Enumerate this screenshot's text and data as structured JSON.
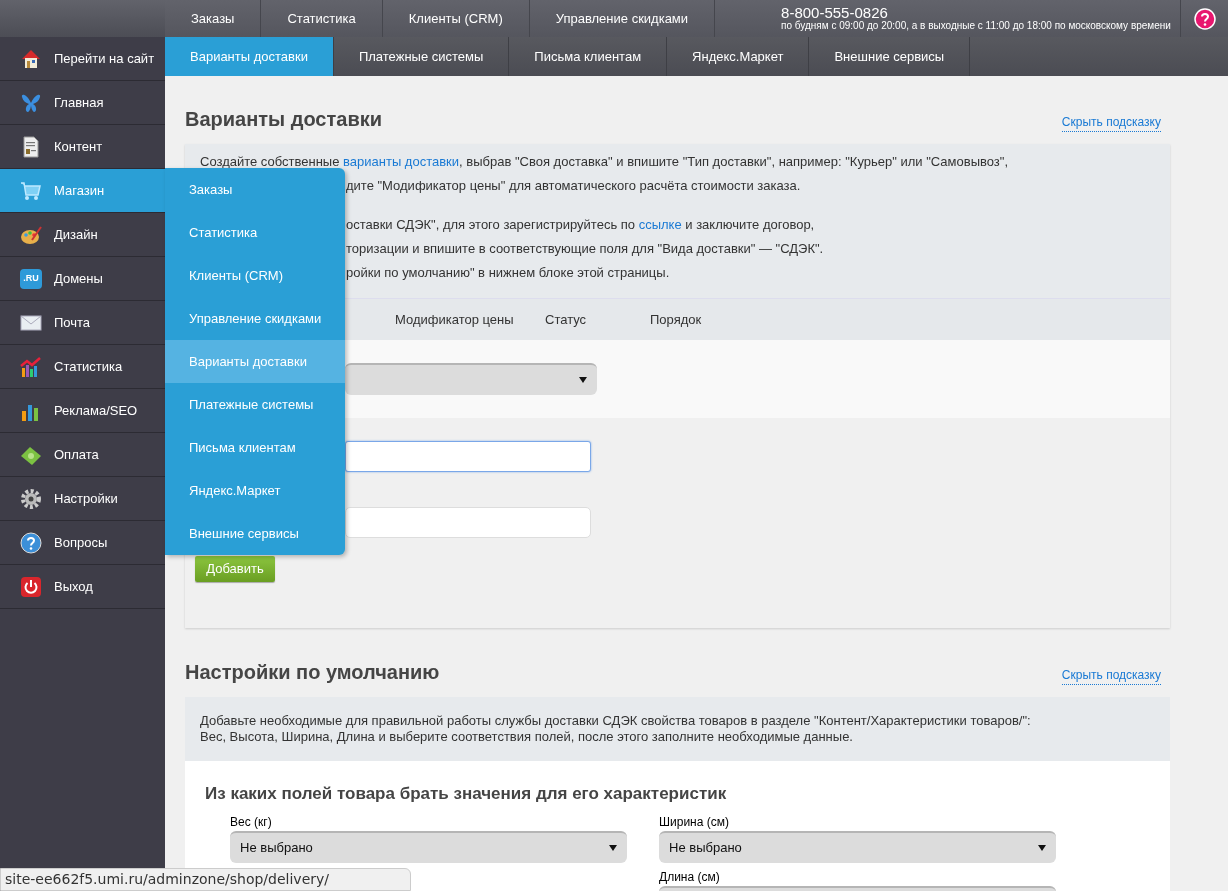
{
  "sidebar": {
    "items": [
      {
        "label": "Перейти на сайт",
        "selected": false
      },
      {
        "label": "Главная",
        "selected": false
      },
      {
        "label": "Контент",
        "selected": false
      },
      {
        "label": "Магазин",
        "selected": true
      },
      {
        "label": "Дизайн",
        "selected": false
      },
      {
        "label": "Домены",
        "selected": false,
        "icon_text": ".RU"
      },
      {
        "label": "Почта",
        "selected": false
      },
      {
        "label": "Статистика",
        "selected": false
      },
      {
        "label": "Реклама/SEO",
        "selected": false
      },
      {
        "label": "Оплата",
        "selected": false
      },
      {
        "label": "Настройки",
        "selected": false
      },
      {
        "label": "Вопросы",
        "selected": false
      },
      {
        "label": "Выход",
        "selected": false
      }
    ]
  },
  "top_tabs": [
    {
      "label": "Заказы",
      "selected": false
    },
    {
      "label": "Статистика",
      "selected": false
    },
    {
      "label": "Клиенты (CRM)",
      "selected": false
    },
    {
      "label": "Управление скидками",
      "selected": false
    }
  ],
  "contact": {
    "phone": "8-800-555-0826",
    "hours": "по будням с 09:00 до 20:00, а в выходные с 11:00 до 18:00 по московскому времени"
  },
  "sub_tabs": [
    {
      "label": "Варианты доставки",
      "selected": true
    },
    {
      "label": "Платежные системы",
      "selected": false
    },
    {
      "label": "Письма клиентам",
      "selected": false
    },
    {
      "label": "Яндекс.Маркет",
      "selected": false
    },
    {
      "label": "Внешние сервисы",
      "selected": false
    }
  ],
  "flyout_menu": [
    {
      "label": "Заказы",
      "selected": false
    },
    {
      "label": "Статистика",
      "selected": false
    },
    {
      "label": "Клиенты (CRM)",
      "selected": false
    },
    {
      "label": "Управление скидками",
      "selected": false
    },
    {
      "label": "Варианты доставки",
      "selected": true
    },
    {
      "label": "Платежные системы",
      "selected": false
    },
    {
      "label": "Письма клиентам",
      "selected": false
    },
    {
      "label": "Яндекс.Маркет",
      "selected": false
    },
    {
      "label": "Внешние сервисы",
      "selected": false
    }
  ],
  "delivery_section": {
    "title": "Варианты доставки",
    "hide_hint": "Скрыть подсказку",
    "hint_paragraphs": [
      [
        [
          {
            "text": "Создайте собственные "
          },
          {
            "text": "варианты доставки",
            "link": true
          },
          {
            "text": ", выбрав \"Своя доставка\" и впишите \"Тип доставки\", например: \"Курьер\" или \"Самовывоз\","
          }
        ],
        [
          {
            "text": "дите \"Модификатор цены\" для автоматического расчёта стоимости заказа."
          }
        ]
      ],
      [
        [
          {
            "text": "оставки СДЭК\", для этого зарегистрируйтесь по "
          },
          {
            "text": "ссылке",
            "link": true
          },
          {
            "text": " и заключите договор,"
          }
        ],
        [
          {
            "text": "торизации и впишите в соответствующие поля для \"Вида доставки\" — \"СДЭК\"."
          }
        ],
        [
          {
            "text": "ройки по умолчанию\" в нижнем блоке этой страницы."
          }
        ]
      ]
    ],
    "columns": [
      "Модификатор цены",
      "Статус",
      "Порядок"
    ],
    "add_button": "Добавить"
  },
  "defaults_section": {
    "title": "Настройки по умолчанию",
    "hide_hint": "Скрыть подсказку",
    "hint": "Добавьте необходимые для правильной работы службы доставки СДЭК свойства товаров в разделе \"Контент/Характеристики товаров/\": Вес, Высота, Ширина, Длина и выберите соответствия полей, после этого заполните необходимые данные.",
    "subtitle": "Из каких полей товара брать значения для его характеристик",
    "left_fields": [
      {
        "label": "Вес (кг)",
        "value": "Не выбрано"
      }
    ],
    "right_fields": [
      {
        "label": "Ширина (см)",
        "value": "Не выбрано"
      },
      {
        "label": "Длина (см)"
      }
    ]
  },
  "status_bar": "site-ee662f5.umi.ru/adminzone/shop/delivery/"
}
